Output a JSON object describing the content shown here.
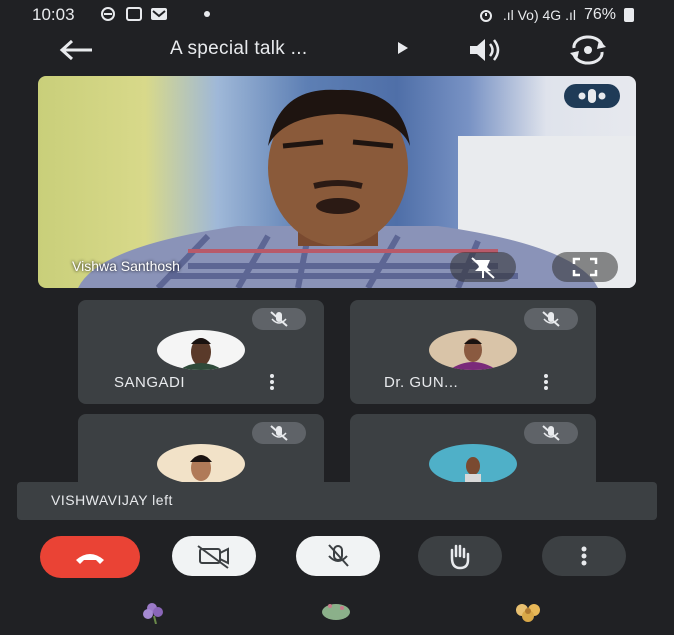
{
  "status_bar": {
    "time": "10:03",
    "network": ".ıl Vo) 4G .ıl",
    "battery": "76%"
  },
  "header": {
    "title": "A special talk ...",
    "back_icon": "arrow-left-icon",
    "speaker_icon": "speaker-icon",
    "switch_camera_icon": "switch-camera-icon"
  },
  "main_tile": {
    "name": "Vishwa Santhosh",
    "unpin_icon": "unpin-icon",
    "fullscreen_icon": "fullscreen-icon"
  },
  "participants": [
    {
      "name": "SANGADI",
      "muted": true
    },
    {
      "name": "Dr. GUN...",
      "muted": true
    },
    {
      "name": "",
      "muted": true
    },
    {
      "name": "",
      "muted": true
    }
  ],
  "toast": {
    "text": "VISHWAVIJAY left"
  },
  "controls": {
    "end_call_color": "#ea4335",
    "items": [
      "end-call-icon",
      "camera-off-icon",
      "mic-off-icon",
      "raise-hand-icon",
      "more-vertical-icon"
    ]
  },
  "colors": {
    "background": "#202124",
    "tile": "#3c4043",
    "accent_pill": "#1f3b57"
  }
}
